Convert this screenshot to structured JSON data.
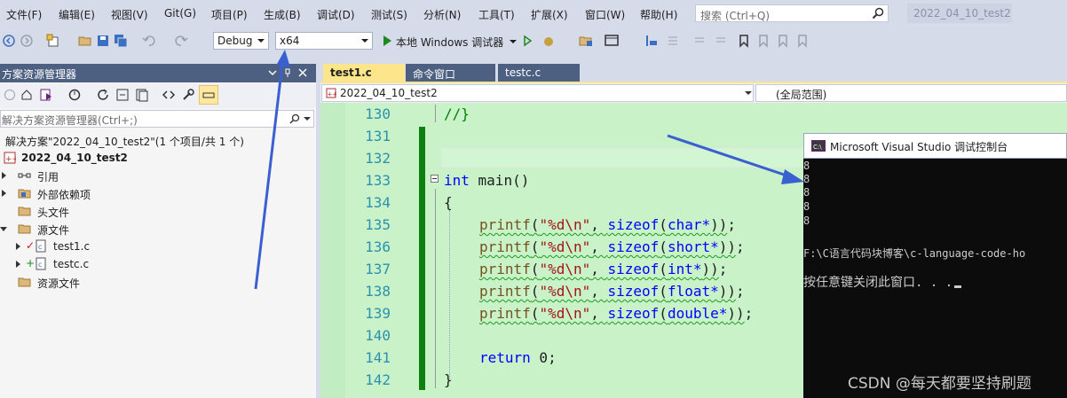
{
  "menu": {
    "items": [
      "文件(F)",
      "编辑(E)",
      "视图(V)",
      "Git(G)",
      "项目(P)",
      "生成(B)",
      "调试(D)",
      "测试(S)",
      "分析(N)",
      "工具(T)",
      "扩展(X)",
      "窗口(W)",
      "帮助(H)"
    ],
    "search_placeholder": "搜索 (Ctrl+Q)",
    "solution_name": "2022_04_10_test2"
  },
  "toolbar": {
    "config": "Debug",
    "platform": "x64",
    "run_label": "本地 Windows 调试器"
  },
  "solution_explorer": {
    "title": "方案资源管理器",
    "search_placeholder": "解决方案资源管理器(Ctrl+;)",
    "tree": [
      {
        "label": "解决方案\"2022_04_10_test2\"(1 个项目/共 1 个)"
      },
      {
        "label": "2022_04_10_test2"
      },
      {
        "label": "引用"
      },
      {
        "label": "外部依赖项"
      },
      {
        "label": "头文件"
      },
      {
        "label": "源文件"
      },
      {
        "label": "test1.c"
      },
      {
        "label": "testc.c"
      },
      {
        "label": "资源文件"
      }
    ]
  },
  "editor": {
    "tabs": [
      "test1.c",
      "命令窗口",
      "testc.c"
    ],
    "nav_project": "2022_04_10_test2",
    "nav_scope": "(全局范围)",
    "line_numbers": [
      "130",
      "131",
      "132",
      "133",
      "134",
      "135",
      "136",
      "137",
      "138",
      "139",
      "140",
      "141",
      "142"
    ],
    "lines": {
      "l130": "//}",
      "l133_kw": "int",
      "l133_rest": " main()",
      "l134": "{",
      "printf": "printf",
      "fmt": "\"%d\\n\"",
      "sizeof": "sizeof",
      "t135": "char*",
      "t136": "short*",
      "t137": "int*",
      "t138": "float*",
      "t139": "double*",
      "l141_kw": "return",
      "l141_rest": " 0;",
      "l142": "}"
    }
  },
  "console": {
    "title": "Microsoft Visual Studio 调试控制台",
    "outputs": [
      "8",
      "8",
      "8",
      "8",
      "8"
    ],
    "path": "F:\\C语言代码块博客\\c-language-code-ho",
    "prompt": "按任意键关闭此窗口. . ."
  },
  "watermark": "CSDN @每天都要坚持刷题",
  "colors": {
    "panel_header": "#4d6082",
    "code_bg": "#c9f2c9",
    "annotation_arrow": "#3a5fd0"
  }
}
